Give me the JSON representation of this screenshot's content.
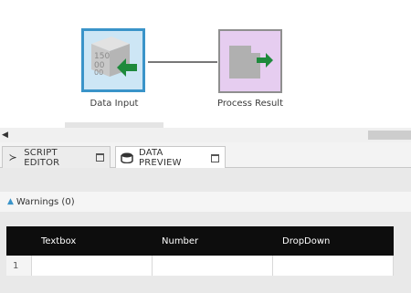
{
  "canvas": {
    "nodes": [
      {
        "label": "Data Input",
        "selected": true,
        "icon": "data-input-icon",
        "fill": "#cde6f5"
      },
      {
        "label": "Process Result",
        "selected": false,
        "icon": "process-result-icon",
        "fill": "#e6cdf0"
      }
    ]
  },
  "tabs": [
    {
      "label": "SCRIPT EDITOR",
      "icon": "terminal-icon",
      "active": false
    },
    {
      "label": "DATA PREVIEW",
      "icon": "database-icon",
      "active": true
    }
  ],
  "warnings": {
    "label": "Warnings (0)"
  },
  "grid": {
    "columns": [
      "Textbox",
      "Number",
      "DropDown"
    ],
    "rows": [
      {
        "num": "1",
        "cells": [
          "",
          "",
          ""
        ]
      }
    ]
  },
  "colors": {
    "accent": "#3a94c9",
    "green_arrow": "#1e8a3c"
  }
}
